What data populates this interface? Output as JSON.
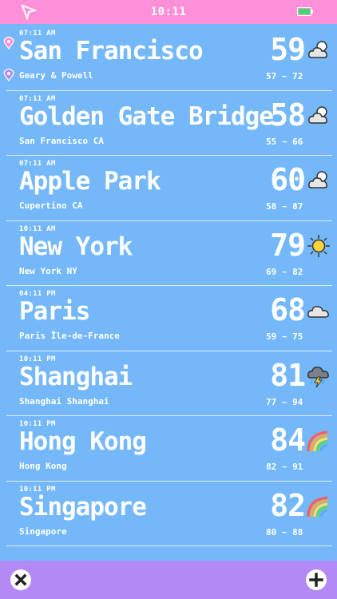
{
  "status": {
    "time": "10:11"
  },
  "locations": [
    {
      "time": "07:11 AM",
      "city": "San Francisco",
      "sub": "Geary & Powell",
      "temp": "59",
      "range": "57 ~ 72",
      "icon": "cloud-sun-icon",
      "pinned": true
    },
    {
      "time": "07:11 AM",
      "city": "Golden Gate Bridge",
      "sub": "San Francisco CA",
      "temp": "58",
      "range": "55 ~ 66",
      "icon": "cloud-sun-icon"
    },
    {
      "time": "07:11 AM",
      "city": "Apple Park",
      "sub": "Cupertino CA",
      "temp": "60",
      "range": "58 ~ 87",
      "icon": "cloud-sun-icon"
    },
    {
      "time": "10:11 AM",
      "city": "New York",
      "sub": "New York NY",
      "temp": "79",
      "range": "69 ~ 82",
      "icon": "sun-icon"
    },
    {
      "time": "04:11 PM",
      "city": "Paris",
      "sub": "Paris Île-de-France",
      "temp": "68",
      "range": "59 ~ 75",
      "icon": "cloud-icon"
    },
    {
      "time": "10:11 PM",
      "city": "Shanghai",
      "sub": "Shanghai Shanghai",
      "temp": "81",
      "range": "77 ~ 94",
      "icon": "thunderstorm-icon"
    },
    {
      "time": "10:11 PM",
      "city": "Hong Kong",
      "sub": "Hong Kong",
      "temp": "84",
      "range": "82 ~ 91",
      "icon": "rainbow-icon"
    },
    {
      "time": "10:11 PM",
      "city": "Singapore",
      "sub": "Singapore",
      "temp": "82",
      "range": "80 ~ 88",
      "icon": "rainbow-icon"
    }
  ],
  "colors": {
    "background": "#74b8fa",
    "status_bar": "#ff8fd8",
    "bottom_bar": "#b389f6",
    "text": "#ffffff"
  }
}
